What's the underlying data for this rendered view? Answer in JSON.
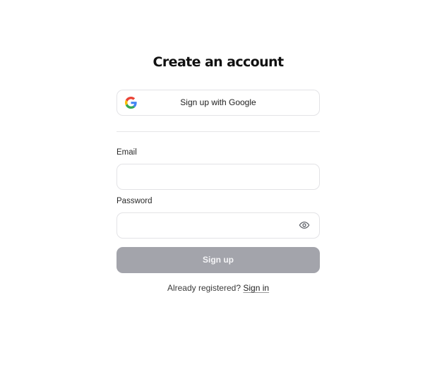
{
  "page": {
    "title": "Create an account"
  },
  "google": {
    "label": "Sign up with Google",
    "icon": "google-icon",
    "colors": {
      "blue": "#4285F4",
      "red": "#EA4335",
      "yellow": "#FBBC05",
      "green": "#34A853"
    }
  },
  "email": {
    "label": "Email",
    "value": "",
    "placeholder": ""
  },
  "password": {
    "label": "Password",
    "value": "",
    "placeholder": "",
    "toggle_icon": "eye-icon"
  },
  "signup": {
    "label": "Sign up",
    "disabled": true,
    "color": "#a3a4ab"
  },
  "signin": {
    "prompt": "Already registered?",
    "link_label": "Sign in"
  }
}
